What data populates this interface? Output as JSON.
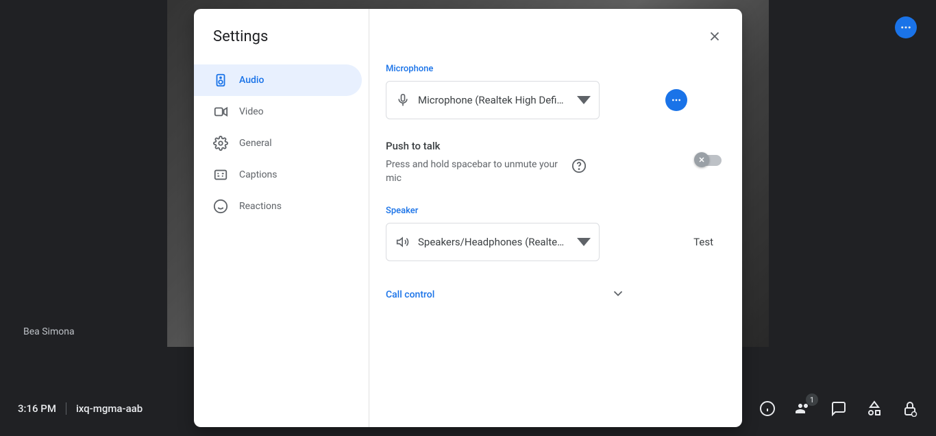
{
  "participant_name": "Bea Simona",
  "bottom": {
    "time": "3:16 PM",
    "meeting_code": "ixq-mgma-aab",
    "people_count": "1"
  },
  "dialog": {
    "title": "Settings",
    "nav": [
      {
        "label": "Audio"
      },
      {
        "label": "Video"
      },
      {
        "label": "General"
      },
      {
        "label": "Captions"
      },
      {
        "label": "Reactions"
      }
    ],
    "audio": {
      "microphone_label": "Microphone",
      "microphone_value": "Microphone (Realtek High Definitio…",
      "ptt_title": "Push to talk",
      "ptt_desc": "Press and hold spacebar to unmute your mic",
      "speaker_label": "Speaker",
      "speaker_value": "Speakers/Headphones (Realtek Hig…",
      "test_label": "Test",
      "call_control_label": "Call control"
    }
  }
}
